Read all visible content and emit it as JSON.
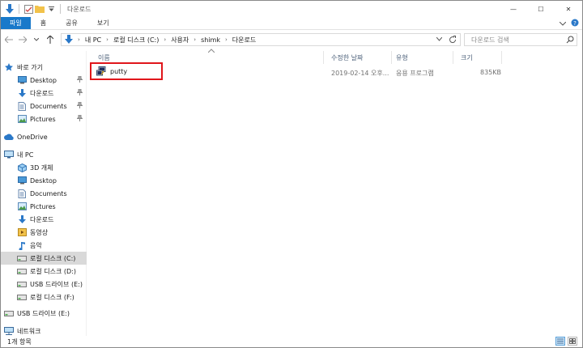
{
  "window": {
    "title": "다운로드",
    "controls": {
      "minimize": "—",
      "maximize": "☐",
      "close": "✕"
    }
  },
  "ribbon": {
    "tabs": [
      "파일",
      "홈",
      "공유",
      "보기"
    ],
    "collapse_icon": "chevron-down-icon",
    "help_icon": "help-icon"
  },
  "address": {
    "breadcrumb": [
      "내 PC",
      "로컬 디스크 (C:)",
      "사용자",
      "shimk",
      "다운로드"
    ],
    "search_placeholder": "다운로드 검색"
  },
  "nav": {
    "items": [
      {
        "label": "바로 가기",
        "icon": "star-icon"
      },
      {
        "label": "Desktop",
        "icon": "desktop-folder-icon",
        "pinned": true
      },
      {
        "label": "다운로드",
        "icon": "download-arrow-icon",
        "pinned": true
      },
      {
        "label": "Documents",
        "icon": "documents-folder-icon",
        "pinned": true
      },
      {
        "label": "Pictures",
        "icon": "pictures-folder-icon",
        "pinned": true
      },
      {
        "label": "OneDrive",
        "icon": "cloud-icon"
      },
      {
        "label": "내 PC",
        "icon": "computer-icon"
      },
      {
        "label": "3D 개체",
        "icon": "3d-objects-icon"
      },
      {
        "label": "Desktop",
        "icon": "desktop-folder-icon"
      },
      {
        "label": "Documents",
        "icon": "documents-folder-icon"
      },
      {
        "label": "Pictures",
        "icon": "pictures-folder-icon"
      },
      {
        "label": "다운로드",
        "icon": "download-arrow-icon"
      },
      {
        "label": "동영상",
        "icon": "video-folder-icon"
      },
      {
        "label": "음악",
        "icon": "music-note-icon"
      },
      {
        "label": "로컬 디스크 (C:)",
        "icon": "drive-icon",
        "selected": true
      },
      {
        "label": "로컬 디스크 (D:)",
        "icon": "drive-icon"
      },
      {
        "label": "USB 드라이브 (E:)",
        "icon": "drive-icon"
      },
      {
        "label": "로컬 디스크 (F:)",
        "icon": "drive-icon"
      },
      {
        "label": "USB 드라이브 (E:)",
        "icon": "drive-icon"
      },
      {
        "label": "네트워크",
        "icon": "network-icon"
      }
    ]
  },
  "columns": [
    "이름",
    "수정한 날짜",
    "유형",
    "크기"
  ],
  "files": [
    {
      "name": "putty",
      "modified": "2019-02-14 오후...",
      "type": "응용 프로그램",
      "size": "835KB",
      "icon": "putty-app-icon"
    }
  ],
  "status": {
    "count_text": "1개 항목"
  },
  "colors": {
    "accent": "#1979ca",
    "highlight_border": "#e0161b",
    "selected_nav": "#d9d9d9"
  }
}
